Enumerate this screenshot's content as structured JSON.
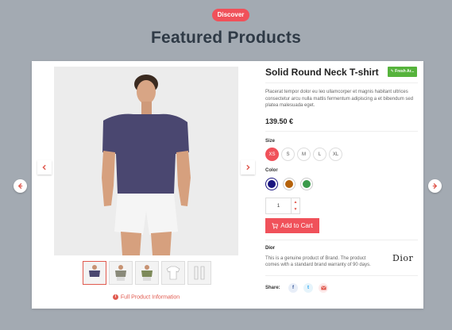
{
  "header": {
    "badge": "Discover",
    "title": "Featured Products"
  },
  "product": {
    "title": "Solid Round Neck T-shirt",
    "badge": "Fresh Ar...",
    "description": "Placerat tempor dolor eu leo ullamcorper et magnis habitant ultrices consectetur arcu nulla mattis fermentum adipiscing a et bibendum sed platea malesuada eget.",
    "price": "139.50 €",
    "size_label": "Size",
    "sizes": [
      "XS",
      "S",
      "M",
      "L",
      "XL"
    ],
    "selected_size": "XS",
    "color_label": "Color",
    "colors": [
      "#1a1580",
      "#b5620a",
      "#3a9a4a"
    ],
    "selected_color": "#1a1580",
    "quantity": "1",
    "add_to_cart": "Add to Cart",
    "brand": {
      "name": "Dior",
      "description": "This is a genuine product of Brand. The product comes with a standard brand warranty of 90 days.",
      "logo": "Dior"
    },
    "share_label": "Share:",
    "full_info": "Full Product Information",
    "thumbnails": [
      "front-view",
      "model-grey",
      "model-olive",
      "flat-lay",
      "size-chart"
    ]
  },
  "icons": {
    "prev": "arrow-left-icon",
    "next": "arrow-right-icon",
    "cart": "cart-icon",
    "info": "info-icon",
    "facebook": "facebook-icon",
    "twitter": "twitter-icon",
    "email": "email-icon",
    "badge": "leaf-icon"
  },
  "colors": {
    "accent": "#f0515a",
    "badge_green": "#56b33c",
    "background": "#a3aab2"
  }
}
